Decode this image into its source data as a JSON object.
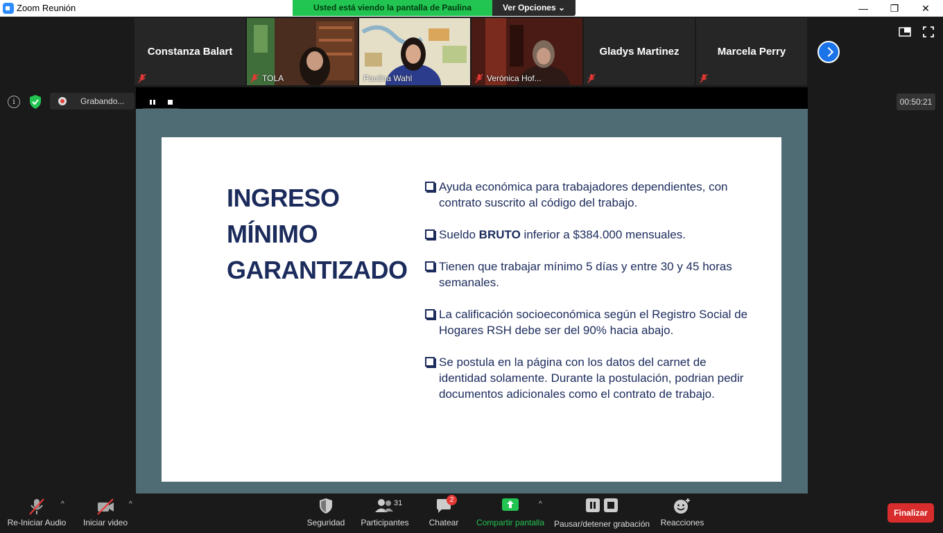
{
  "window": {
    "title": "Zoom Reunión",
    "min": "—",
    "restore": "❐",
    "close": "✕"
  },
  "banner": {
    "message": "Usted está viendo la pantalla de Paulina Wahl",
    "options": "Ver Opciones ⌄"
  },
  "participants": [
    {
      "name": "Constanza Balart",
      "label": ""
    },
    {
      "name": "",
      "label": "TOLA"
    },
    {
      "name": "",
      "label": "Paulina Wahl"
    },
    {
      "name": "",
      "label": "Verónica Hof..."
    },
    {
      "name": "Gladys Martinez",
      "label": ""
    },
    {
      "name": "Marcela Perry",
      "label": ""
    }
  ],
  "status": {
    "info": "i",
    "recording": "Grabando...",
    "timer": "00:50:21"
  },
  "slide": {
    "title": [
      "INGRESO",
      "MÍNIMO",
      "GARANTIZADO"
    ],
    "bullets": [
      {
        "pre": "Ayuda económica para trabajadores dependientes, con contrato suscrito al código del trabajo.",
        "bold": "",
        "post": ""
      },
      {
        "pre": "Sueldo ",
        "bold": "BRUTO",
        "post": " inferior a $384.000 mensuales."
      },
      {
        "pre": "Tienen que trabajar mínimo 5 días y entre 30 y 45 horas semanales.",
        "bold": "",
        "post": ""
      },
      {
        "pre": "La calificación socioeconómica según el Registro Social de Hogares RSH debe ser del 90% hacia abajo.",
        "bold": "",
        "post": ""
      },
      {
        "pre": "Se postula en la página con los datos del carnet de identidad solamente. Durante la postulación, podrian pedir documentos adicionales como el contrato de trabajo.",
        "bold": "",
        "post": ""
      }
    ]
  },
  "toolbar": {
    "audio": "Re-Iniciar Audio",
    "video": "Iniciar video",
    "security": "Seguridad",
    "participants": "Participantes",
    "participants_count": "31",
    "chat": "Chatear",
    "chat_badge": "2",
    "share": "Compartir pantalla",
    "record": "Pausar/detener grabación",
    "reactions": "Reacciones",
    "end": "Finalizar",
    "caret": "^"
  },
  "colors": {
    "accent_green": "#23c552",
    "slide_text": "#1b2b5c",
    "share_bg": "#4f6b73",
    "end_red": "#d92c2c"
  }
}
